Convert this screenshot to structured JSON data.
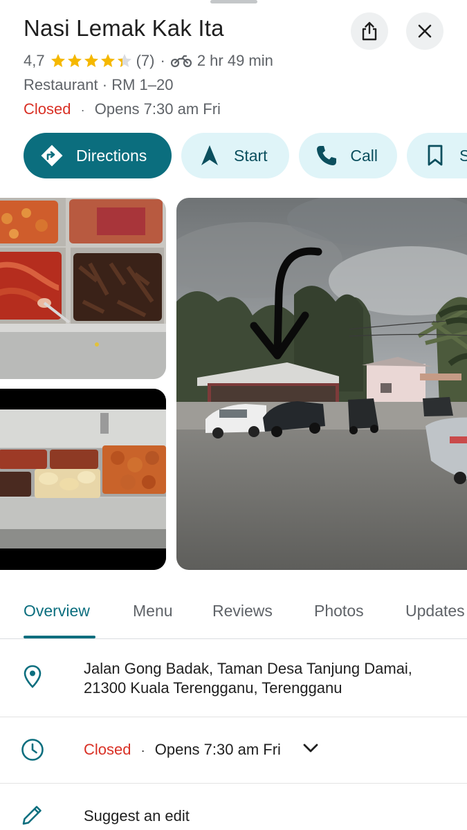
{
  "place": {
    "name": "Nasi Lemak Kak Ita",
    "rating": "4,7",
    "review_count": "(7)",
    "travel_time": "2 hr 49 min",
    "category": "Restaurant",
    "price": "RM 1–20",
    "status": "Closed",
    "opens": "Opens 7:30 am Fri",
    "star_rating_value": 4.7
  },
  "actions": {
    "directions": "Directions",
    "start": "Start",
    "call": "Call",
    "save_partial": "S"
  },
  "tabs": [
    {
      "label": "Overview"
    },
    {
      "label": "Menu"
    },
    {
      "label": "Reviews"
    },
    {
      "label": "Photos"
    },
    {
      "label": "Updates"
    }
  ],
  "info": {
    "address_line1": "Jalan Gong Badak, Taman Desa Tanjung Damai,",
    "address_line2": "21300 Kuala Terengganu, Terengganu",
    "hours_status": "Closed",
    "hours_opens": "Opens 7:30 am Fri",
    "suggest_edit": "Suggest an edit"
  },
  "separator": "·",
  "colors": {
    "accent": "#0b6e7e",
    "chip_bg": "#dff4f8",
    "star": "#f5b800",
    "closed": "#d93025"
  }
}
